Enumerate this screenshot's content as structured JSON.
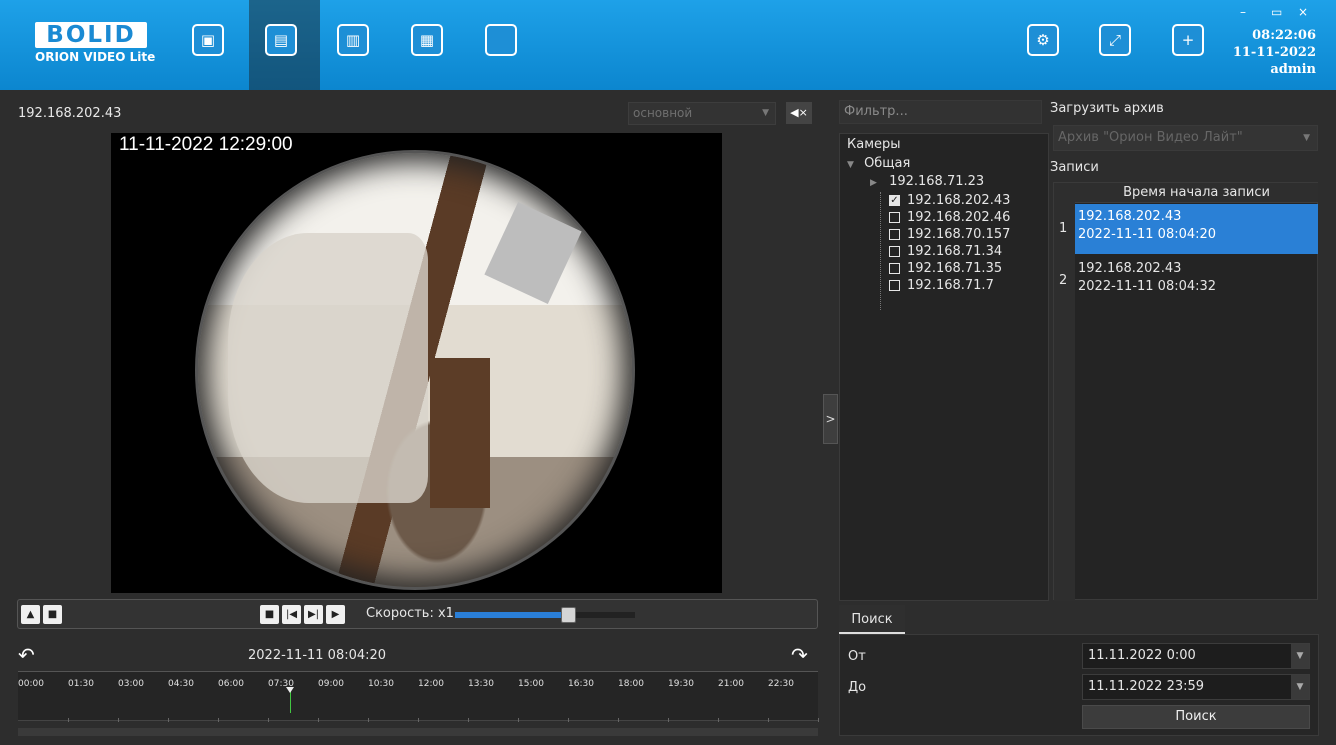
{
  "app": {
    "logo_word": "BOLID",
    "logo_sub": "ORION VIDEO Lite",
    "accent_color": "#0c86cf"
  },
  "nav": {
    "items": [
      {
        "icon": "camera-icon"
      },
      {
        "icon": "archive-clapper-icon"
      },
      {
        "icon": "report-search-icon"
      },
      {
        "icon": "plan-icon"
      },
      {
        "icon": "monitor-icon"
      }
    ],
    "active_index": 1
  },
  "header_right": {
    "settings_icon": "gear-icon",
    "fullscreen_icon": "expand-icon",
    "add_window_icon": "add-window-icon"
  },
  "clock": {
    "time": "08:22:06",
    "date": "11-11-2022",
    "user": "admin"
  },
  "player": {
    "camera": "192.168.202.43",
    "stream_select": "основной",
    "timestamp_overlay": "11-11-2022 12:29:00",
    "speed_label": "Скорость: x1",
    "speed_level": 0.63
  },
  "timeline": {
    "current": "2022-11-11 08:04:20",
    "ticks": [
      "00:00",
      "01:30",
      "03:00",
      "04:30",
      "06:00",
      "07:30",
      "09:00",
      "10:30",
      "12:00",
      "13:30",
      "15:00",
      "16:30",
      "18:00",
      "19:30",
      "21:00",
      "22:30"
    ],
    "marker_time": "08:04:20"
  },
  "cameras": {
    "filter_placeholder": "Фильтр...",
    "title": "Камеры",
    "group": "Общая",
    "subgroup": "192.168.71.23",
    "items": [
      {
        "ip": "192.168.202.43",
        "checked": true
      },
      {
        "ip": "192.168.202.46",
        "checked": false
      },
      {
        "ip": "192.168.70.157",
        "checked": false
      },
      {
        "ip": "192.168.71.34",
        "checked": false
      },
      {
        "ip": "192.168.71.35",
        "checked": false
      },
      {
        "ip": "192.168.71.7",
        "checked": false
      }
    ]
  },
  "archive": {
    "load_label": "Загрузить архив",
    "source": "Архив \"Орион Видео Лайт\"",
    "records_label": "Записи",
    "column": "Время начала записи",
    "records": [
      {
        "num": "1",
        "ip": "192.168.202.43",
        "time": "2022-11-11 08:04:20",
        "selected": true
      },
      {
        "num": "2",
        "ip": "192.168.202.43",
        "time": "2022-11-11 08:04:32",
        "selected": false
      }
    ]
  },
  "search": {
    "tab": "Поиск",
    "from_label": "От",
    "from_value": "11.11.2022 0:00",
    "to_label": "До",
    "to_value": "11.11.2022 23:59",
    "button": "Поиск"
  },
  "collapse": {
    "label": ">"
  }
}
